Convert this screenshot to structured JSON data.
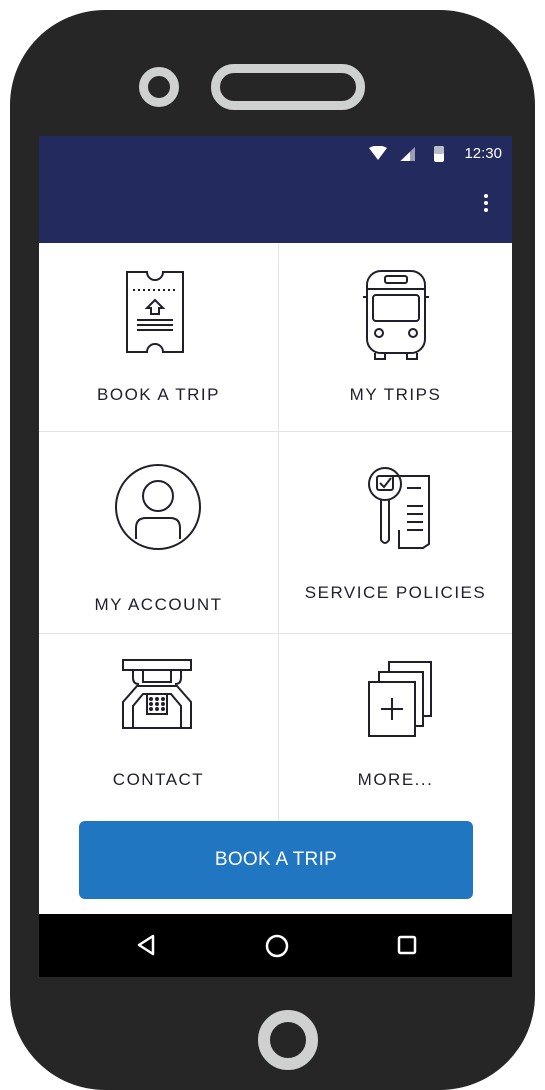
{
  "status_bar": {
    "time": "12:30",
    "wifi_icon": "wifi-icon",
    "signal_icon": "signal-icon",
    "battery_icon": "battery-icon"
  },
  "toolbar": {
    "menu_icon": "overflow-menu-icon"
  },
  "menu": [
    {
      "label": "BOOK A TRIP",
      "icon": "ticket-icon"
    },
    {
      "label": "MY TRIPS",
      "icon": "bus-icon"
    },
    {
      "label": "MY ACCOUNT",
      "icon": "user-icon"
    },
    {
      "label": "SERVICE POLICIES",
      "icon": "policy-document-icon"
    },
    {
      "label": "CONTACT",
      "icon": "telephone-icon"
    },
    {
      "label": "MORE...",
      "icon": "stacked-pages-add-icon"
    }
  ],
  "cta": {
    "label": "BOOK A TRIP"
  },
  "nav": {
    "back": "back-icon",
    "home": "home-icon",
    "recents": "recents-icon"
  },
  "colors": {
    "header": "#232a5e",
    "cta": "#2176c1",
    "phone_body": "#262626",
    "phone_accent": "#cfd1d0"
  }
}
